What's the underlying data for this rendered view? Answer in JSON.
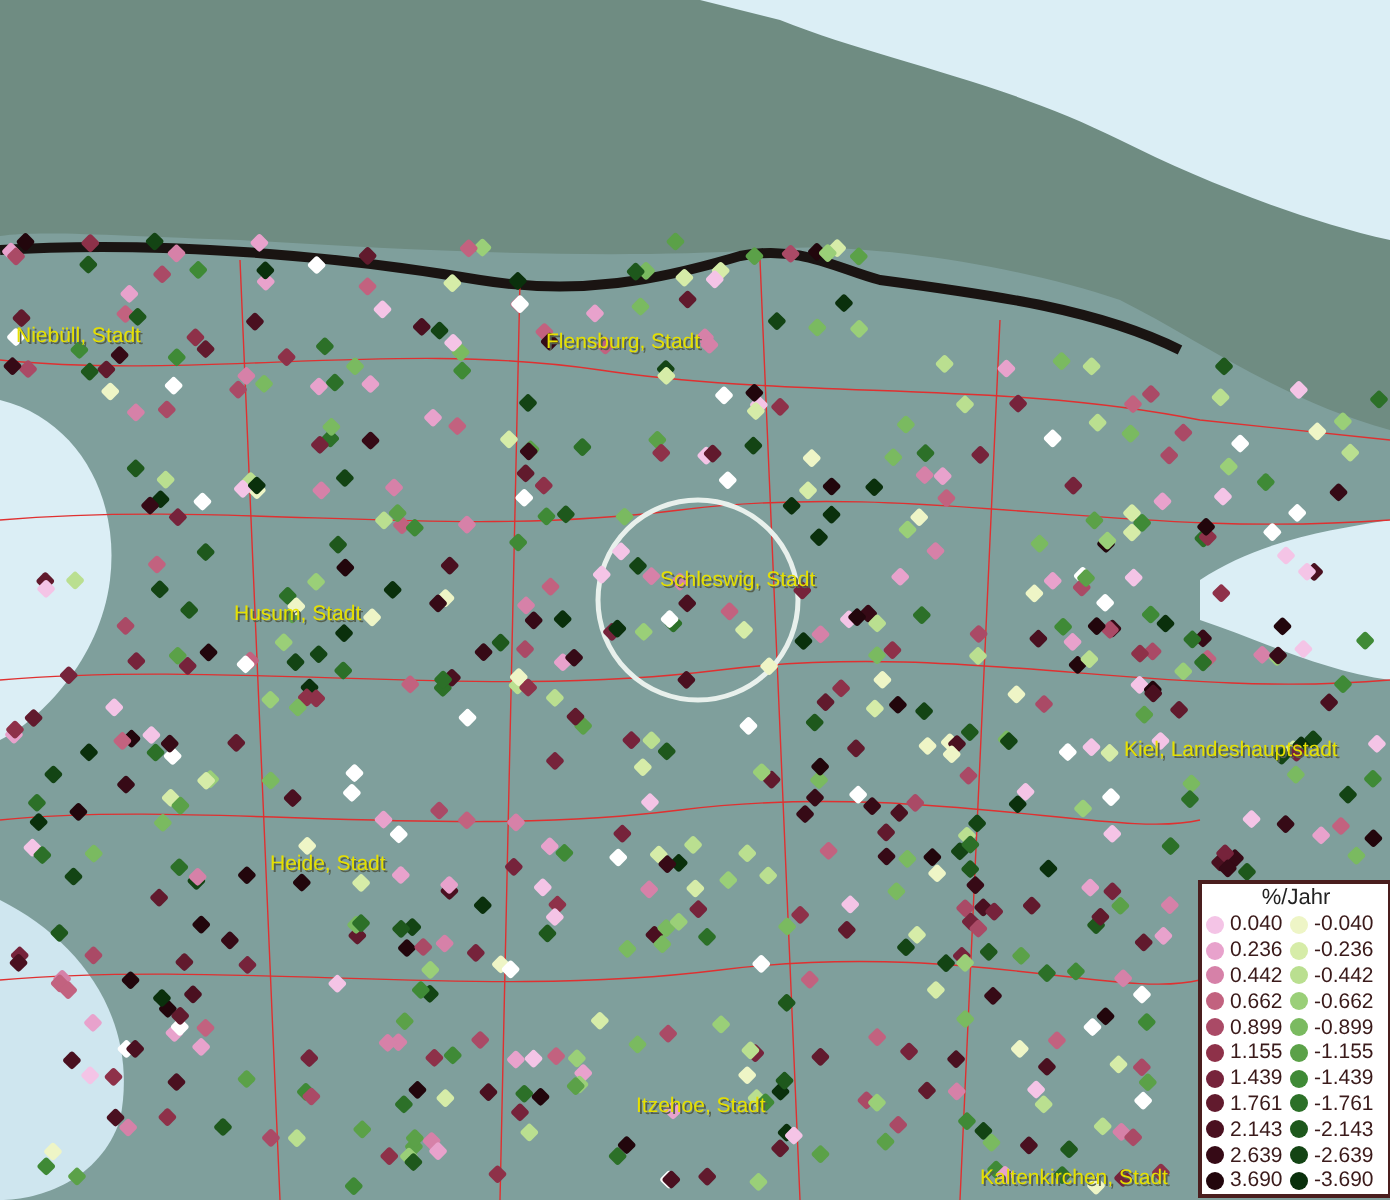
{
  "cities": [
    {
      "name": "Niebüll, Stadt"
    },
    {
      "name": "Flensburg, Stadt"
    },
    {
      "name": "Schleswig, Stadt"
    },
    {
      "name": "Husum, Stadt"
    },
    {
      "name": "Kiel, Landeshauptstadt"
    },
    {
      "name": "Heide, Stadt"
    },
    {
      "name": "Itzehoe, Stadt"
    },
    {
      "name": "Kaltenkirchen, Stadt"
    }
  ],
  "legend": {
    "title": "%/Jahr",
    "positive": [
      {
        "value": "0.040",
        "color": "#f4c4e6"
      },
      {
        "value": "0.236",
        "color": "#e8a2cc"
      },
      {
        "value": "0.442",
        "color": "#d681a8"
      },
      {
        "value": "0.662",
        "color": "#c2627f"
      },
      {
        "value": "0.899",
        "color": "#aa4a66"
      },
      {
        "value": "1.155",
        "color": "#8e3149"
      },
      {
        "value": "1.439",
        "color": "#76233b"
      },
      {
        "value": "1.761",
        "color": "#611a2d"
      },
      {
        "value": "2.143",
        "color": "#4a1020"
      },
      {
        "value": "2.639",
        "color": "#360a16"
      },
      {
        "value": "3.690",
        "color": "#22060c"
      }
    ],
    "negative": [
      {
        "value": "-0.040",
        "color": "#eef5c6"
      },
      {
        "value": "-0.236",
        "color": "#d6eca8"
      },
      {
        "value": "-0.442",
        "color": "#badf90"
      },
      {
        "value": "-0.662",
        "color": "#9acf78"
      },
      {
        "value": "-0.899",
        "color": "#7aba60"
      },
      {
        "value": "-1.155",
        "color": "#5ba148"
      },
      {
        "value": "-1.439",
        "color": "#3f8a36"
      },
      {
        "value": "-1.761",
        "color": "#2c7028"
      },
      {
        "value": "-2.143",
        "color": "#1e581c"
      },
      {
        "value": "-2.639",
        "color": "#134414"
      },
      {
        "value": "-3.690",
        "color": "#0a300c"
      }
    ]
  }
}
